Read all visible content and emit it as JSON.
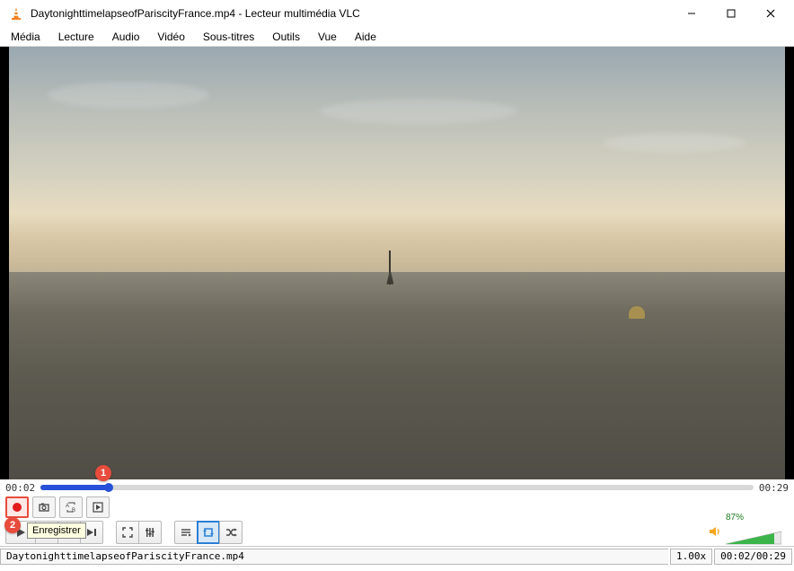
{
  "window": {
    "title": "DaytonighttimelapseofPariscityFrance.mp4 - Lecteur multimédia VLC"
  },
  "menu": {
    "items": [
      "Média",
      "Lecture",
      "Audio",
      "Vidéo",
      "Sous-titres",
      "Outils",
      "Vue",
      "Aide"
    ]
  },
  "playback": {
    "current_time": "00:02",
    "total_time": "00:29"
  },
  "tooltip": {
    "record": "Enregistrer"
  },
  "status": {
    "filename": "DaytonighttimelapseofPariscityFrance.mp4",
    "speed": "1.00x",
    "time_display": "00:02/00:29"
  },
  "volume": {
    "percent_label": "87%"
  },
  "annotations": {
    "a1": "1",
    "a2": "2"
  }
}
